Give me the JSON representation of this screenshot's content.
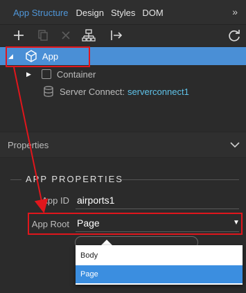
{
  "tabs": {
    "items": [
      "App Structure",
      "Design",
      "Styles",
      "DOM"
    ],
    "more": "»"
  },
  "toolbar": {
    "icons": [
      "plus-icon",
      "copy-icon",
      "delete-icon",
      "structure-icon",
      "move-out-icon",
      "refresh-icon"
    ]
  },
  "tree": {
    "app_label": "App",
    "container_label": "Container",
    "server_connect_label": "Server Connect:",
    "server_connect_value": "serverconnect1"
  },
  "properties": {
    "header": "Properties",
    "section_title": "APP PROPERTIES",
    "app_id_label": "App ID",
    "app_id_value": "airports1",
    "app_root_label": "App Root",
    "app_root_value": "Page"
  },
  "dropdown": {
    "options": [
      "Body",
      "Page"
    ],
    "selected": "Page"
  },
  "colors": {
    "accent": "#4a8fd6",
    "annotation_red": "#e0161c",
    "link": "#5fc3ea"
  }
}
